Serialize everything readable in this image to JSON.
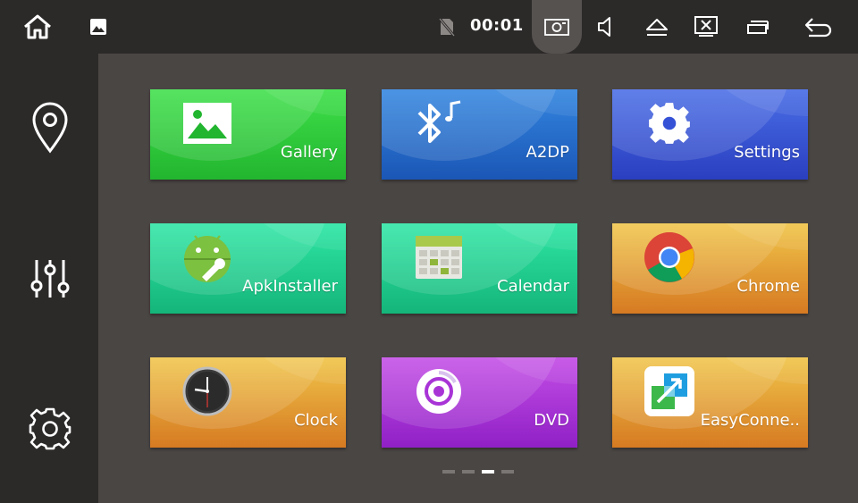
{
  "status_bar": {
    "time": "00:01"
  },
  "tiles": [
    {
      "label": "Gallery"
    },
    {
      "label": "A2DP"
    },
    {
      "label": "Settings"
    },
    {
      "label": "ApkInstaller"
    },
    {
      "label": "Calendar"
    },
    {
      "label": "Chrome"
    },
    {
      "label": "Clock"
    },
    {
      "label": "DVD"
    },
    {
      "label": "EasyConne.."
    }
  ],
  "pager": {
    "pages": 4,
    "active_page": 3
  },
  "colors": {
    "background": "#4a4644",
    "bar": "#2c2a29",
    "gallery": "#2cc83a",
    "a2dp": "#2a6fd0",
    "settings": "#3552d6",
    "apkinstaller": "#20cf8f",
    "chrome": "#e3a23a",
    "dvd": "#a834d6"
  }
}
